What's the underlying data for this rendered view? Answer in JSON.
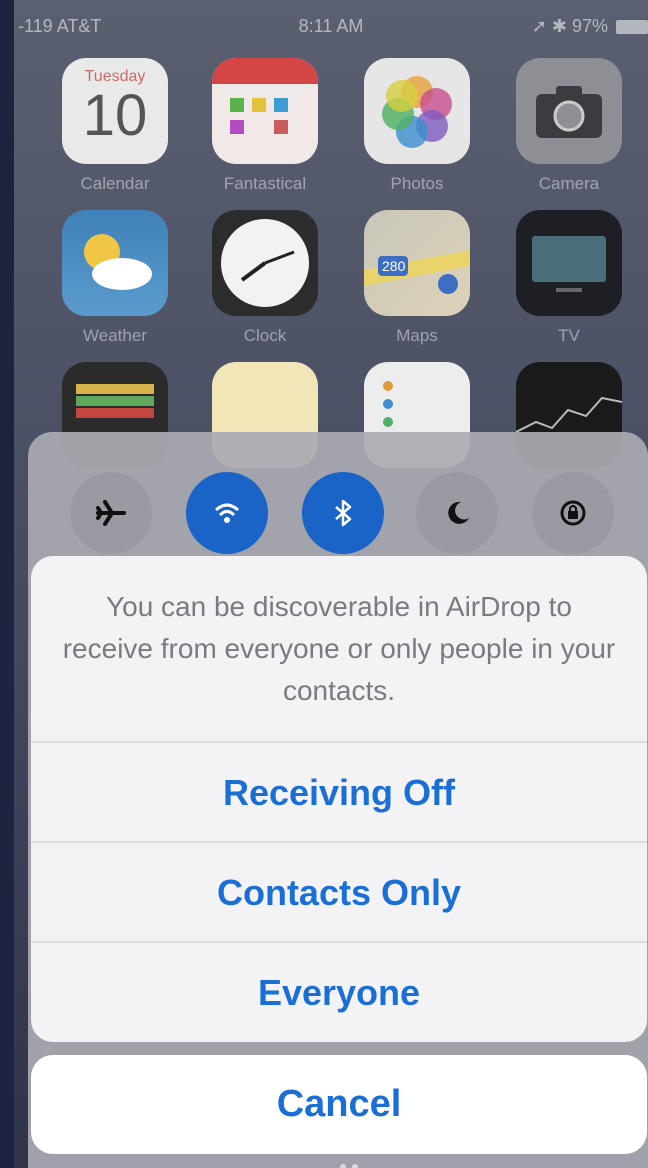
{
  "status_bar": {
    "carrier": "-119 AT&T",
    "time": "8:11 AM",
    "battery": "97%"
  },
  "home_screen": {
    "apps": [
      {
        "label": "Calendar",
        "day": "Tuesday",
        "date": "10"
      },
      {
        "label": "Fantastical"
      },
      {
        "label": "Photos"
      },
      {
        "label": "Camera"
      },
      {
        "label": "Weather"
      },
      {
        "label": "Clock"
      },
      {
        "label": "Maps",
        "badge": "280"
      },
      {
        "label": "TV"
      },
      {
        "label": "Wallet"
      },
      {
        "label": "Notes"
      },
      {
        "label": "Reminders"
      },
      {
        "label": "Stocks"
      }
    ]
  },
  "control_center": {
    "toggles": [
      {
        "name": "airplane-mode",
        "on": false
      },
      {
        "name": "wifi",
        "on": true
      },
      {
        "name": "bluetooth",
        "on": true
      },
      {
        "name": "do-not-disturb",
        "on": false
      },
      {
        "name": "rotation-lock",
        "on": false
      }
    ]
  },
  "action_sheet": {
    "message": "You can be discoverable in AirDrop to receive from everyone or only people in your contacts.",
    "options": [
      "Receiving Off",
      "Contacts Only",
      "Everyone"
    ],
    "cancel": "Cancel"
  },
  "colors": {
    "accent": "#1a6fd6",
    "toggle_on": "#1a64c8"
  }
}
